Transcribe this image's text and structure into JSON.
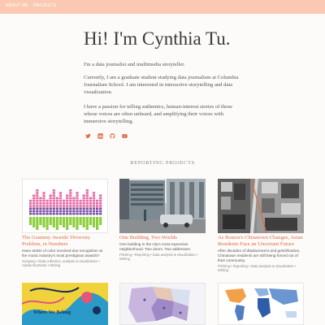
{
  "nav": {
    "about_label": "ABOUT ME",
    "projects_label": "PROJECTS"
  },
  "hero": {
    "title": "Hi! I'm Cynthia Tu."
  },
  "bio": {
    "p1": "I'm a data journalist and multimedia storyteller.",
    "p2": "Currently, I am a graduate student studying data journalism at Columbia Journalism School. I am interested in interactive storytelling and data visualization.",
    "p3": "I have a passion for telling authentics, human-interest stories of those whose voices are often unheard, and amplifying their voices with immersive storytelling."
  },
  "social": [
    "twitter-icon",
    "linkedin-icon",
    "github-icon",
    "youtube-icon"
  ],
  "section": {
    "title": "REPORTING PROJECTS"
  },
  "projects": [
    {
      "title": "The Grammy Awards' Diversity Problem, in Numbers",
      "description": "Have artists of color received due recognition at the music industry's most prestigious awards?",
      "tags": "Scraping • Data collection, analysis & visualization • Adobe Illustrator • Writing"
    },
    {
      "title": "One Building, Two Worlds",
      "description": "One building in the city's most expensive neighborhood. Two doors. Two addresses.",
      "tags": "Pitching • Reporting • Data analysis & visualization • Writing"
    },
    {
      "title": "As Boston's Chinatown Changes, Asian Residents Face an Uncertain Future",
      "description": "After decades of displacement and gentrification, Chinatown residents are still being forced out of their community.",
      "tags": "Pitching • Reporting • Data analysis & visualization • Writing"
    },
    {
      "overlay": "Where We Belong"
    },
    {},
    {}
  ],
  "colors": {
    "nav_bg": "#fbc9b1",
    "accent": "#e0693f",
    "social_icons": "#e0693f"
  }
}
